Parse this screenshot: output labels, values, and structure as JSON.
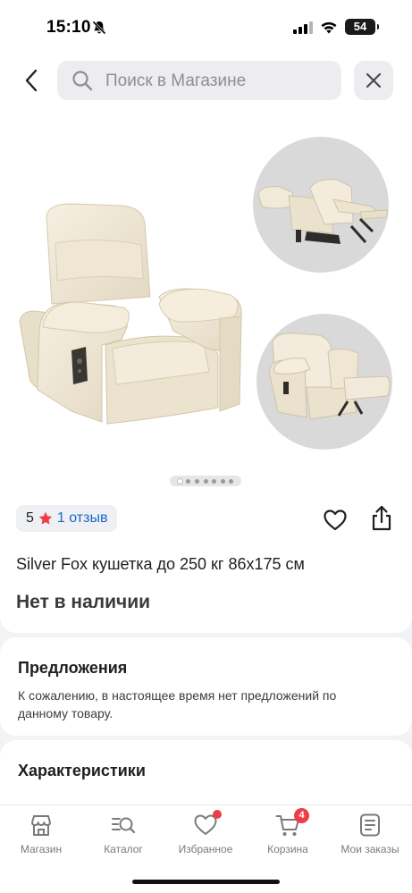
{
  "status_bar": {
    "time": "15:10",
    "battery": "54"
  },
  "search": {
    "placeholder": "Поиск в Магазине"
  },
  "gallery": {
    "dot_count": 7,
    "active_index": 0
  },
  "product": {
    "rating": "5",
    "reviews": "1 отзыв",
    "title": "Silver Fox кушетка до 250 кг 86x175 см",
    "stock_status": "Нет в наличии"
  },
  "offers": {
    "title": "Предложения",
    "text": "К сожалению, в настоящее время нет предложений по данному товару."
  },
  "specs": {
    "title": "Характеристики"
  },
  "nav": {
    "items": [
      {
        "label": "Магазин",
        "icon": "store-icon"
      },
      {
        "label": "Каталог",
        "icon": "catalog-search-icon"
      },
      {
        "label": "Избранное",
        "icon": "heart-icon"
      },
      {
        "label": "Корзина",
        "icon": "cart-icon",
        "badge": "4"
      },
      {
        "label": "Мои заказы",
        "icon": "orders-icon"
      }
    ]
  },
  "colors": {
    "accent_link": "#1a66c9",
    "badge": "#ee3d48",
    "star": "#ee3d48"
  }
}
